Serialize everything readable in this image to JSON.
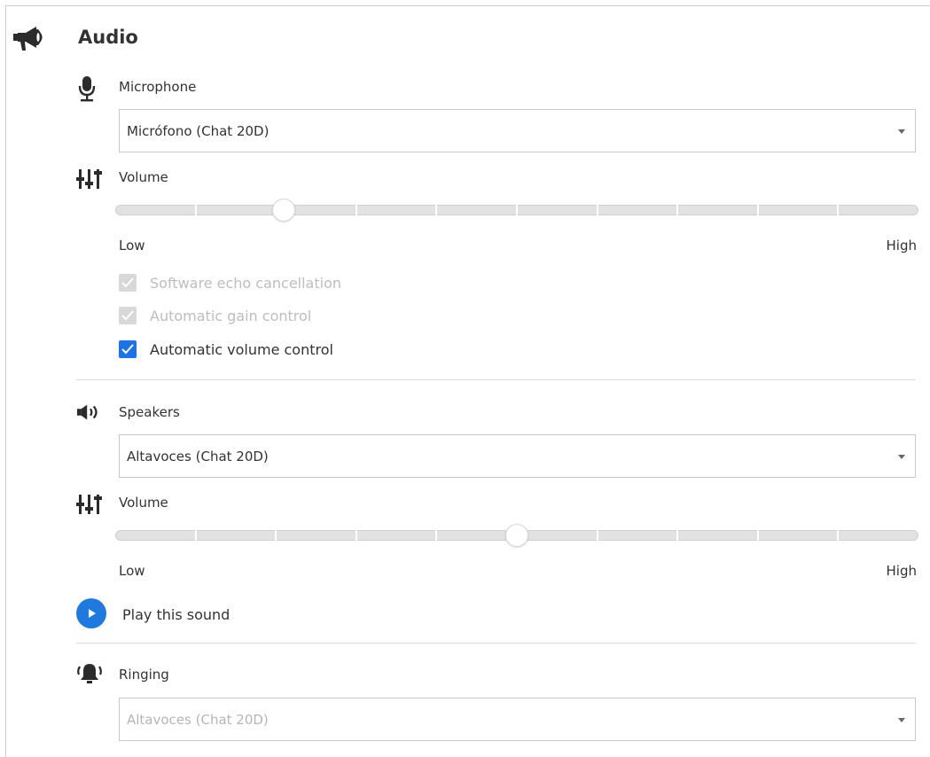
{
  "section": {
    "title": "Audio",
    "icon": "megaphone-icon"
  },
  "microphone": {
    "label": "Microphone",
    "icon": "microphone-icon",
    "selected": "Micrófono (Chat 20D)",
    "volume": {
      "label": "Volume",
      "icon": "sliders-icon",
      "level": 0.21,
      "low_label": "Low",
      "high_label": "High"
    },
    "options": [
      {
        "label": "Software echo cancellation",
        "checked": true,
        "disabled": true
      },
      {
        "label": "Automatic gain control",
        "checked": true,
        "disabled": true
      },
      {
        "label": "Automatic volume control",
        "checked": true,
        "disabled": false
      }
    ]
  },
  "speakers": {
    "label": "Speakers",
    "icon": "speaker-icon",
    "selected": "Altavoces (Chat 20D)",
    "volume": {
      "label": "Volume",
      "icon": "sliders-icon",
      "level": 0.5,
      "low_label": "Low",
      "high_label": "High"
    },
    "play_label": "Play this sound"
  },
  "ringing": {
    "label": "Ringing",
    "icon": "bell-icon",
    "selected": "Altavoces (Chat 20D)",
    "disabled": true
  },
  "colors": {
    "accent": "#1a73e8",
    "text": "#333333",
    "disabled_text": "#bdbdbd",
    "border": "#c8c8c8"
  }
}
